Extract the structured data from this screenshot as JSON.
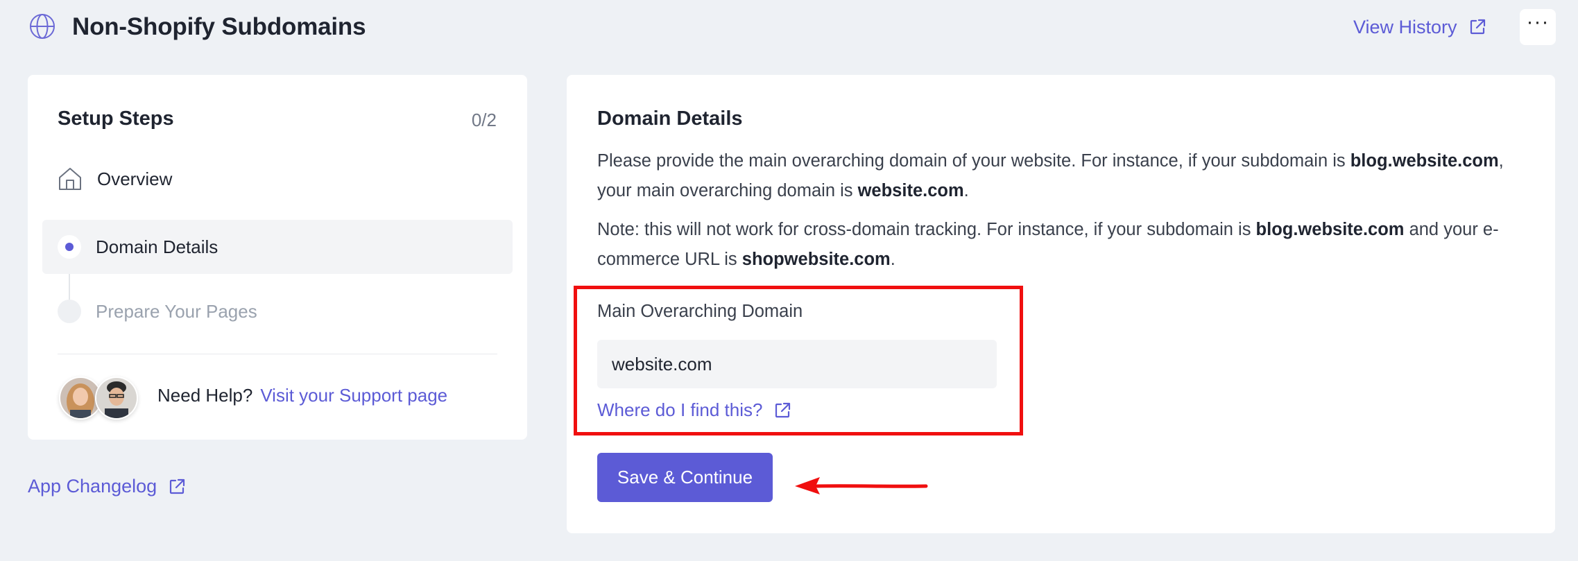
{
  "header": {
    "title": "Non-Shopify Subdomains",
    "view_history": "View History",
    "more_label": "···"
  },
  "setup": {
    "title": "Setup Steps",
    "count": "0/2",
    "steps": [
      {
        "label": "Overview"
      },
      {
        "label": "Domain Details"
      },
      {
        "label": "Prepare Your Pages"
      }
    ],
    "help_text": "Need Help?",
    "help_link": "Visit your Support page"
  },
  "changelog": "App Changelog",
  "domain": {
    "title": "Domain Details",
    "p1_a": "Please provide the main overarching domain of your website. For instance, if your subdomain is ",
    "p1_b": "blog.website.com",
    "p1_c": ", your main overarching domain is ",
    "p1_d": "website.com",
    "p1_e": ".",
    "p2_a": "Note: this will not work for cross-domain tracking. For instance, if your subdomain is ",
    "p2_b": "blog.website.com",
    "p2_c": " and your e-commerce URL is ",
    "p2_d": "shopwebsite.com",
    "p2_e": ".",
    "field_label": "Main Overarching Domain",
    "field_value": "website.com",
    "find_link": "Where do I find this?",
    "save": "Save & Continue"
  },
  "colors": {
    "accent": "#5c5bd6",
    "annotation": "#f00f0f",
    "background": "#eef1f5"
  },
  "icons": [
    "globe-icon",
    "external-link-icon",
    "more-icon",
    "home-icon",
    "arrow-annotation"
  ]
}
